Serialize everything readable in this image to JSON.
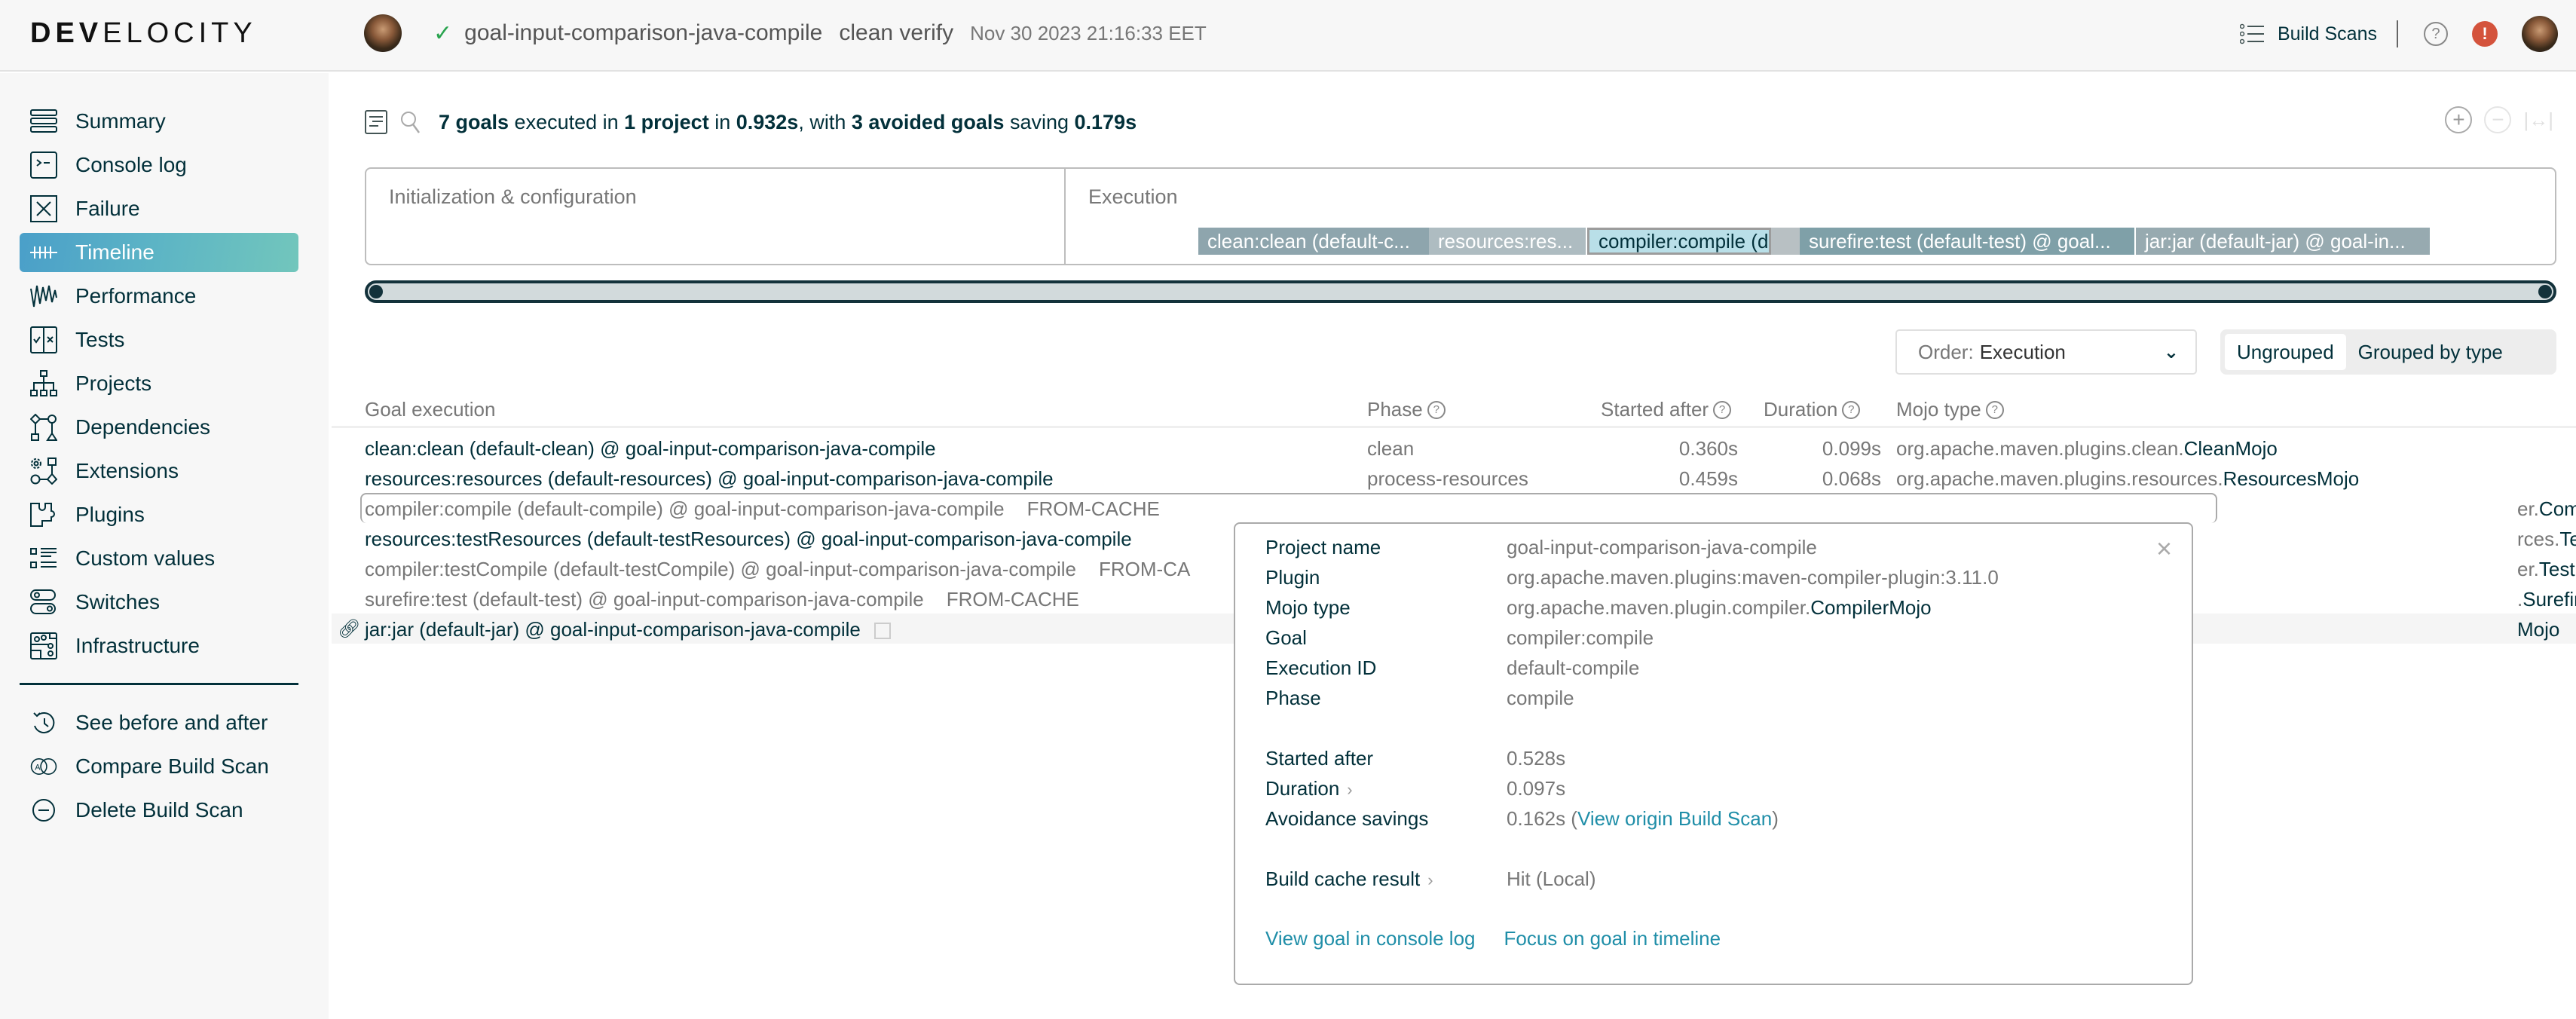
{
  "app": {
    "logo_bold": "DEV",
    "logo_thin": "ELOCITY"
  },
  "header": {
    "status_icon": "check-icon",
    "project": "goal-input-comparison-java-compile",
    "tasks": "clean verify",
    "date": "Nov 30 2023 21:16:33 EET",
    "build_scans_label": "Build Scans",
    "help_icon": "?",
    "alert_icon": "!"
  },
  "sidebar": {
    "items": [
      {
        "label": "Summary",
        "icon": "summary-icon"
      },
      {
        "label": "Console log",
        "icon": "console-icon"
      },
      {
        "label": "Failure",
        "icon": "failure-icon"
      },
      {
        "label": "Timeline",
        "icon": "timeline-icon",
        "active": true
      },
      {
        "label": "Performance",
        "icon": "performance-icon"
      },
      {
        "label": "Tests",
        "icon": "tests-icon"
      },
      {
        "label": "Projects",
        "icon": "projects-icon"
      },
      {
        "label": "Dependencies",
        "icon": "dependencies-icon"
      },
      {
        "label": "Extensions",
        "icon": "extensions-icon"
      },
      {
        "label": "Plugins",
        "icon": "plugins-icon"
      },
      {
        "label": "Custom values",
        "icon": "custom-values-icon"
      },
      {
        "label": "Switches",
        "icon": "switches-icon"
      },
      {
        "label": "Infrastructure",
        "icon": "infrastructure-icon"
      }
    ],
    "actions": [
      {
        "label": "See before and after",
        "icon": "history-icon"
      },
      {
        "label": "Compare Build Scan",
        "icon": "compare-icon"
      },
      {
        "label": "Delete Build Scan",
        "icon": "delete-icon"
      }
    ]
  },
  "summary": {
    "goals_count": "7 goals",
    "executed_in": " executed in ",
    "projects": "1 project",
    "in": " in ",
    "total_time": "0.932s",
    "with": ", with ",
    "avoided": "3 avoided goals",
    "saving": " saving ",
    "saved_time": "0.179s"
  },
  "zoom_controls": {
    "zoom_in": "+",
    "zoom_out": "−",
    "fit": "|↔|"
  },
  "timeline": {
    "init_label": "Initialization & configuration",
    "exec_label": "Execution",
    "bars": [
      {
        "label": "clean:clean (default-c...",
        "color": "#8ea5ad"
      },
      {
        "label": "resources:res...",
        "color": "#aebcc1"
      },
      {
        "label": "compiler:compile (de...",
        "color": "#b9dfe8",
        "selected": true
      },
      {
        "label": "",
        "color": "#b8c0c3"
      },
      {
        "label": "surefire:test (default-test) @ goal...",
        "color": "#7fa0a8"
      },
      {
        "label": "jar:jar (default-jar) @ goal-in...",
        "color": "#97aab0"
      }
    ]
  },
  "controls": {
    "order_prefix": "Order:",
    "order_value": "Execution",
    "group_options": [
      "Ungrouped",
      "Grouped by type"
    ],
    "group_active": "Ungrouped"
  },
  "table": {
    "headers": {
      "goal": "Goal execution",
      "phase": "Phase",
      "started": "Started after",
      "duration": "Duration",
      "mojo": "Mojo type"
    },
    "rows": [
      {
        "goal": "clean:clean (default-clean) @ goal-input-comparison-java-compile",
        "tag": "",
        "phase": "clean",
        "started": "0.360s",
        "duration": "0.099s",
        "mojo_pkg": "org.apache.maven.plugins.clean.",
        "mojo_cls": "CleanMojo",
        "avoided": false
      },
      {
        "goal": "resources:resources (default-resources) @ goal-input-comparison-java-compile",
        "tag": "",
        "phase": "process-resources",
        "started": "0.459s",
        "duration": "0.068s",
        "mojo_pkg": "org.apache.maven.plugins.resources.",
        "mojo_cls": "ResourcesMojo",
        "avoided": false
      },
      {
        "goal": "compiler:compile (default-compile) @ goal-input-comparison-java-compile",
        "tag": "FROM-CACHE",
        "phase": "",
        "started": "",
        "duration": "",
        "mojo_pkg": "er.",
        "mojo_cls": "CompilerMojo",
        "avoided": true
      },
      {
        "goal": "resources:testResources (default-testResources) @ goal-input-comparison-java-compile",
        "tag": "",
        "phase": "",
        "started": "",
        "duration": "",
        "mojo_pkg": "rces.",
        "mojo_cls": "TestResourcesMojo",
        "avoided": false
      },
      {
        "goal": "compiler:testCompile (default-testCompile) @ goal-input-comparison-java-compile",
        "tag": "FROM-CA",
        "phase": "",
        "started": "",
        "duration": "",
        "mojo_pkg": "er.",
        "mojo_cls": "TestCompilerMojo",
        "avoided": true
      },
      {
        "goal": "surefire:test (default-test) @ goal-input-comparison-java-compile",
        "tag": "FROM-CACHE",
        "phase": "",
        "started": "",
        "duration": "",
        "mojo_pkg": ".",
        "mojo_cls": "SurefirePlugin",
        "avoided": true
      },
      {
        "goal": "jar:jar (default-jar) @ goal-input-comparison-java-compile",
        "tag": "",
        "phase": "",
        "started": "",
        "duration": "",
        "mojo_pkg": "",
        "mojo_cls": "Mojo",
        "avoided": false
      }
    ]
  },
  "popup": {
    "close": "×",
    "project_name_k": "Project name",
    "project_name_v": "goal-input-comparison-java-compile",
    "plugin_k": "Plugin",
    "plugin_v": "org.apache.maven.plugins:maven-compiler-plugin:3.11.0",
    "mojo_k": "Mojo type",
    "mojo_pkg": "org.apache.maven.plugin.compiler.",
    "mojo_cls": "CompilerMojo",
    "goal_k": "Goal",
    "goal_v": "compiler:compile",
    "exec_k": "Execution ID",
    "exec_v": "default-compile",
    "phase_k": "Phase",
    "phase_v": "compile",
    "started_k": "Started after",
    "started_v": "0.528s",
    "duration_k": "Duration",
    "duration_v": "0.097s",
    "savings_k": "Avoidance savings",
    "savings_v": "0.162s (",
    "savings_link": "View origin Build Scan",
    "savings_end": ")",
    "cache_k": "Build cache result",
    "cache_v": "Hit (Local)",
    "link_console": "View goal in console log",
    "link_focus": "Focus on goal in timeline"
  }
}
